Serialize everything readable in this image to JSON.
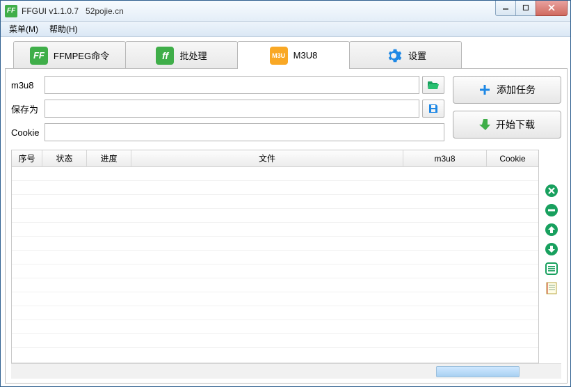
{
  "window": {
    "app_icon_text": "FF",
    "title": "FFGUI v1.1.0.7",
    "extra": "52pojie.cn"
  },
  "menu": {
    "menu_m": "菜单(M)",
    "help_h": "帮助(H)"
  },
  "tabs": {
    "ffmpeg": "FFMPEG命令",
    "batch": "批处理",
    "m3u8": "M3U8",
    "m3u_icon": "M3U",
    "settings": "设置"
  },
  "form": {
    "m3u8_label": "m3u8",
    "m3u8_value": "",
    "save_as_label": "保存为",
    "save_as_value": "",
    "cookie_label": "Cookie",
    "cookie_value": ""
  },
  "buttons": {
    "add_task": "添加任务",
    "start_download": "开始下载"
  },
  "table": {
    "headers": {
      "index": "序号",
      "status": "状态",
      "progress": "进度",
      "file": "文件",
      "m3u8": "m3u8",
      "cookie": "Cookie"
    },
    "rows": []
  }
}
